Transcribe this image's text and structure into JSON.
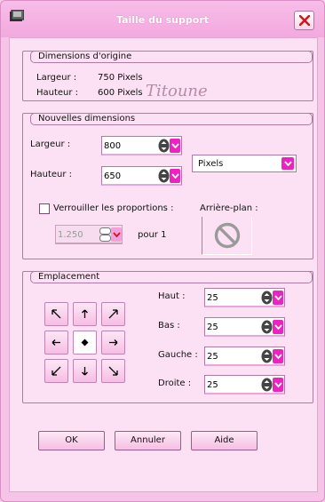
{
  "window": {
    "title": "Taille du support"
  },
  "original": {
    "group_title": "Dimensions d'origine",
    "width_label": "Largeur :",
    "width_value": "750 Pixels",
    "height_label": "Hauteur :",
    "height_value": "600 Pixels",
    "signature": "Titoune"
  },
  "new_dims": {
    "group_title": "Nouvelles dimensions",
    "width_label": "Largeur :",
    "width_value": "800",
    "height_label": "Hauteur :",
    "height_value": "650",
    "unit_value": "Pixels",
    "lock_label": "Verrouiller les proportions :",
    "lock_checked": false,
    "ratio_value": "1.250",
    "ratio_suffix": "pour 1",
    "background_label": "Arrière-plan :"
  },
  "placement": {
    "group_title": "Emplacement",
    "top_label": "Haut :",
    "top_value": "25",
    "bottom_label": "Bas :",
    "bottom_value": "25",
    "left_label": "Gauche :",
    "left_value": "25",
    "right_label": "Droite :",
    "right_value": "25"
  },
  "buttons": {
    "ok": "OK",
    "cancel": "Annuler",
    "help": "Aide"
  },
  "colors": {
    "accent": "#ee22c2",
    "window_bg": "#f6c4e7",
    "client_bg": "#fbe1f3"
  }
}
